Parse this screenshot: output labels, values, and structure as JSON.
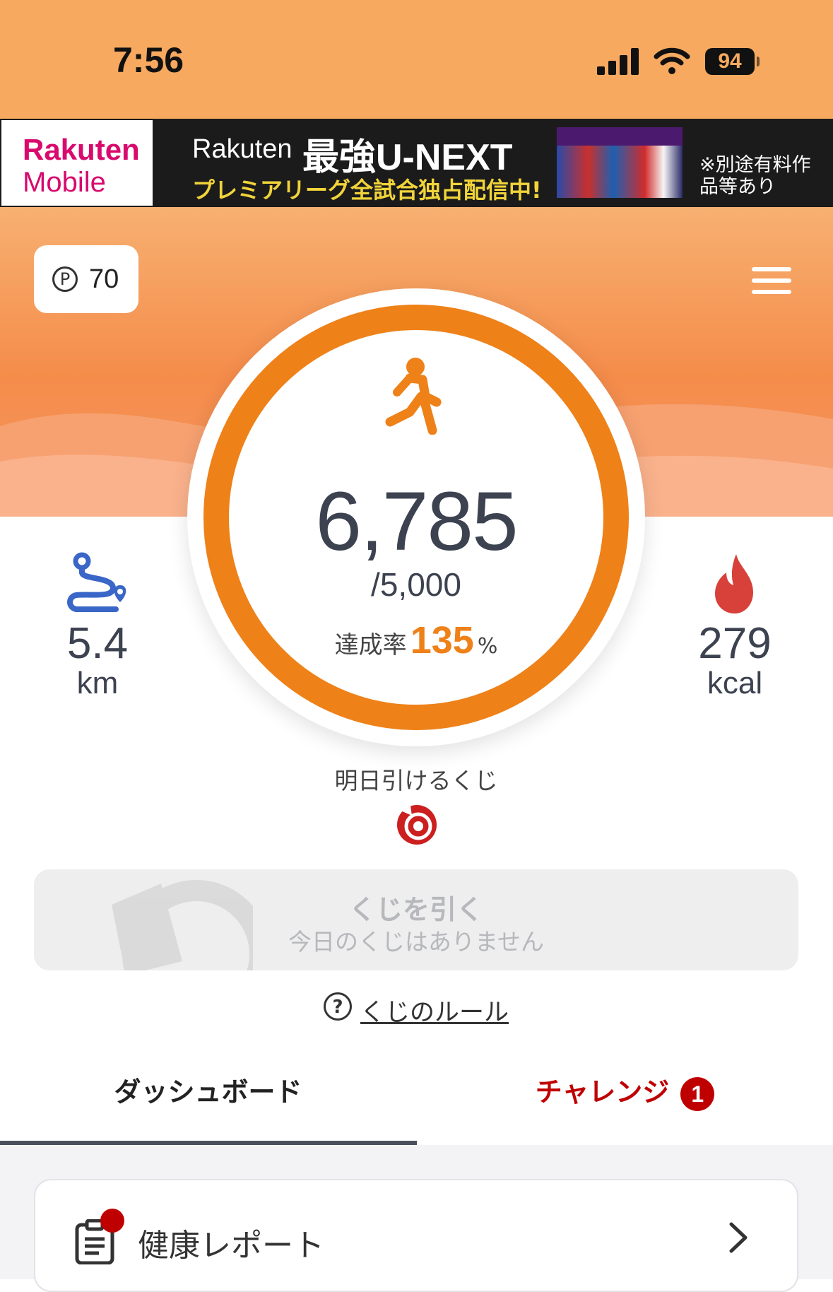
{
  "status_bar": {
    "time": "7:56",
    "battery": "94"
  },
  "banner": {
    "logo_line1": "Rakuten",
    "logo_line2": "Mobile",
    "rakuten": "Rakuten",
    "title": "最強U-NEXT",
    "subtitle": "プレミアリーグ全試合独占配信中!",
    "note": "※別途有料作品等あり"
  },
  "points": {
    "value": "70"
  },
  "steps": {
    "count": "6,785",
    "goal": "/5,000",
    "rate_label": "達成率",
    "rate_value": "135",
    "rate_unit": "%"
  },
  "distance": {
    "value": "5.4",
    "unit": "km"
  },
  "calories": {
    "value": "279",
    "unit": "kcal"
  },
  "lottery": {
    "title": "明日引けるくじ",
    "button_title": "くじを引く",
    "button_subtitle": "今日のくじはありません",
    "rules_link": "くじのルール"
  },
  "tabs": {
    "dashboard": "ダッシュボード",
    "challenge": "チャレンジ",
    "challenge_badge": "1"
  },
  "cards": {
    "health_report": "健康レポート"
  },
  "colors": {
    "accent": "#ee8118",
    "brand_red": "#bf0000",
    "header": "#f6a95f"
  }
}
